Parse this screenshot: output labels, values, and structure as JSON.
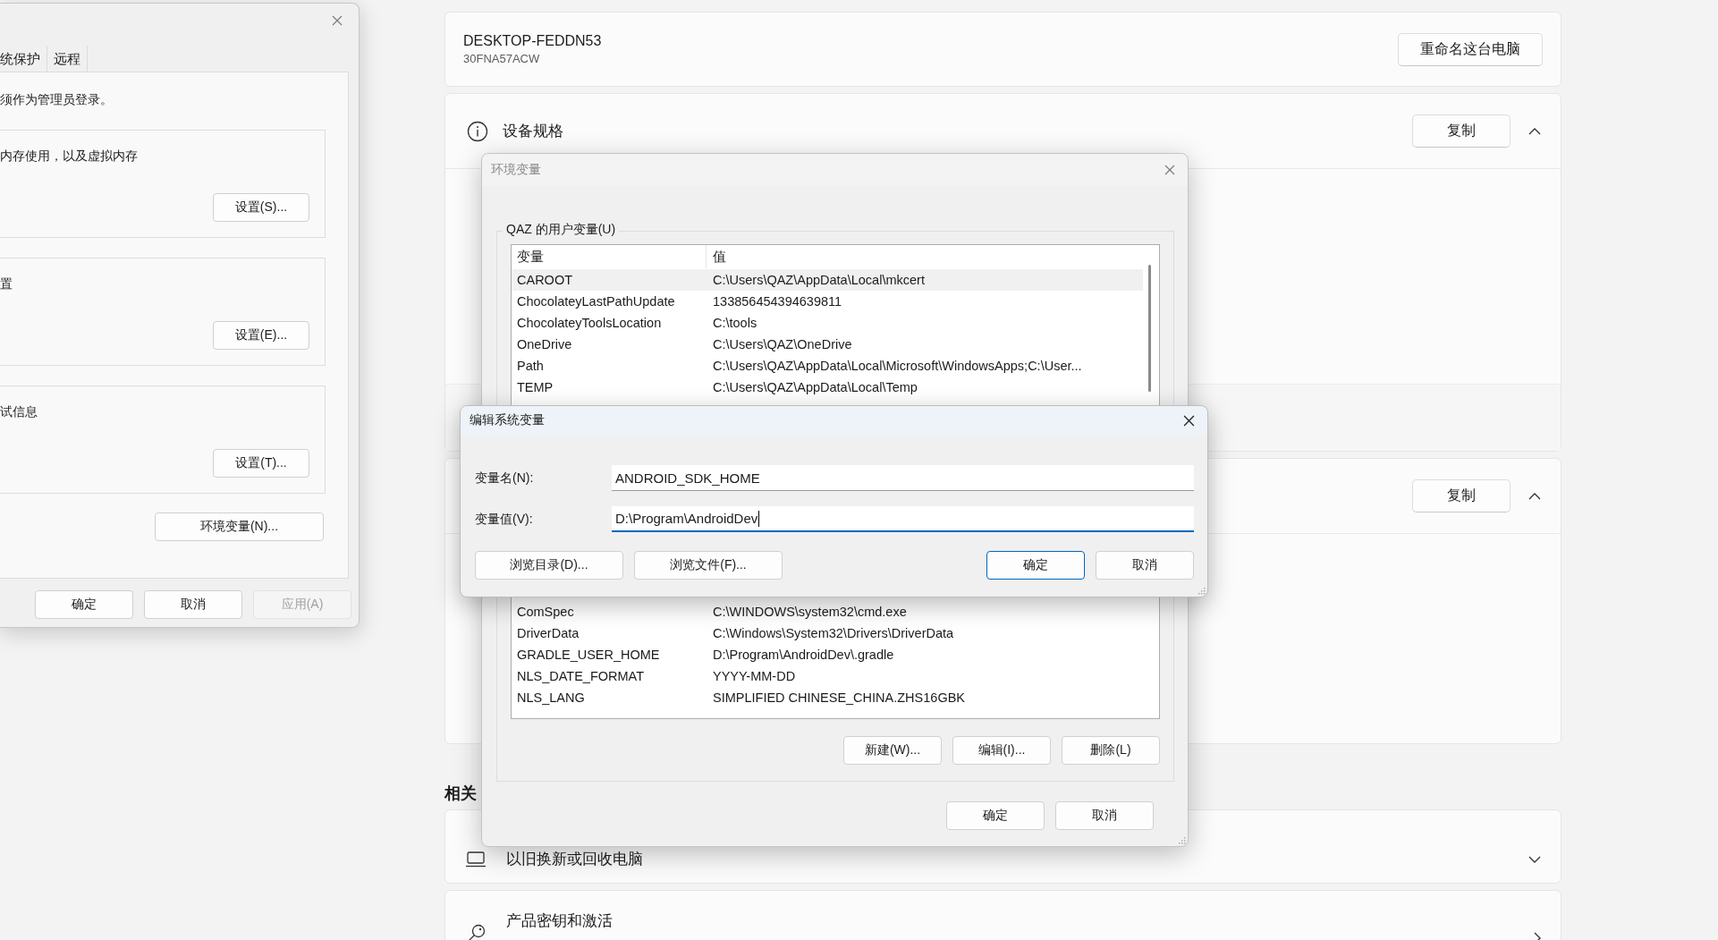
{
  "settings_page": {
    "device": {
      "name": "DESKTOP-FEDDN53",
      "model": "30FNA57ACW",
      "rename_button": "重命名这台电脑"
    },
    "sections": [
      {
        "title": "设备规格",
        "copy_button": "复制",
        "expanded": true
      },
      {
        "copy_button": "复制",
        "expanded": true
      }
    ],
    "related_heading": "相关",
    "related_items": [
      {
        "title": "以旧换新或回收电脑",
        "kind": "expand"
      },
      {
        "title": "产品密钥和激活",
        "kind": "link"
      }
    ]
  },
  "system_properties": {
    "tabs": [
      {
        "label": "统保护",
        "selected": false
      },
      {
        "label": "远程",
        "selected": false
      }
    ],
    "admin_note": "须作为管理员登录。",
    "groups": [
      {
        "text": "内存使用，以及虚拟内存",
        "button": "设置(S)..."
      },
      {
        "text": "置",
        "button": "设置(E)..."
      },
      {
        "text": "试信息",
        "button": "设置(T)..."
      }
    ],
    "env_button": "环境变量(N)...",
    "buttons": [
      {
        "label": "确定",
        "disabled": false
      },
      {
        "label": "取消",
        "disabled": false
      },
      {
        "label": "应用(A)",
        "disabled": true
      }
    ]
  },
  "env_dialog": {
    "title": "环境变量",
    "active": false,
    "user_group": "QAZ 的用户变量(U)",
    "columns": [
      "变量",
      "值"
    ],
    "user_rows": [
      {
        "name": "CAROOT",
        "value": "C:\\Users\\QAZ\\AppData\\Local\\mkcert",
        "selected": true
      },
      {
        "name": "ChocolateyLastPathUpdate",
        "value": "133856454394639811",
        "selected": false
      },
      {
        "name": "ChocolateyToolsLocation",
        "value": "C:\\tools",
        "selected": false
      },
      {
        "name": "OneDrive",
        "value": "C:\\Users\\QAZ\\OneDrive",
        "selected": false
      },
      {
        "name": "Path",
        "value": "C:\\Users\\QAZ\\AppData\\Local\\Microsoft\\WindowsApps;C:\\User...",
        "selected": false
      },
      {
        "name": "TEMP",
        "value": "C:\\Users\\QAZ\\AppData\\Local\\Temp",
        "selected": false
      }
    ],
    "system_rows": [
      {
        "name": "ComSpec",
        "value": "C:\\WINDOWS\\system32\\cmd.exe",
        "selected": false
      },
      {
        "name": "DriverData",
        "value": "C:\\Windows\\System32\\Drivers\\DriverData",
        "selected": false
      },
      {
        "name": "GRADLE_USER_HOME",
        "value": "D:\\Program\\AndroidDev\\.gradle",
        "selected": false
      },
      {
        "name": "NLS_DATE_FORMAT",
        "value": "YYYY-MM-DD",
        "selected": false
      },
      {
        "name": "NLS_LANG",
        "value": "SIMPLIFIED CHINESE_CHINA.ZHS16GBK",
        "selected": false
      }
    ],
    "list_buttons": [
      "新建(W)...",
      "编辑(I)...",
      "删除(L)"
    ],
    "buttons": [
      "确定",
      "取消"
    ]
  },
  "edit_dialog": {
    "title": "编辑系统变量",
    "fields": [
      {
        "label": "变量名(N):",
        "value": "ANDROID_SDK_HOME",
        "focused": false
      },
      {
        "label": "变量值(V):",
        "value": "D:\\Program\\AndroidDev",
        "focused": true
      }
    ],
    "buttons": [
      {
        "label": "浏览目录(D)...",
        "default": false
      },
      {
        "label": "浏览文件(F)...",
        "default": false
      },
      {
        "label": "确定",
        "default": true
      },
      {
        "label": "取消",
        "default": false
      }
    ]
  }
}
